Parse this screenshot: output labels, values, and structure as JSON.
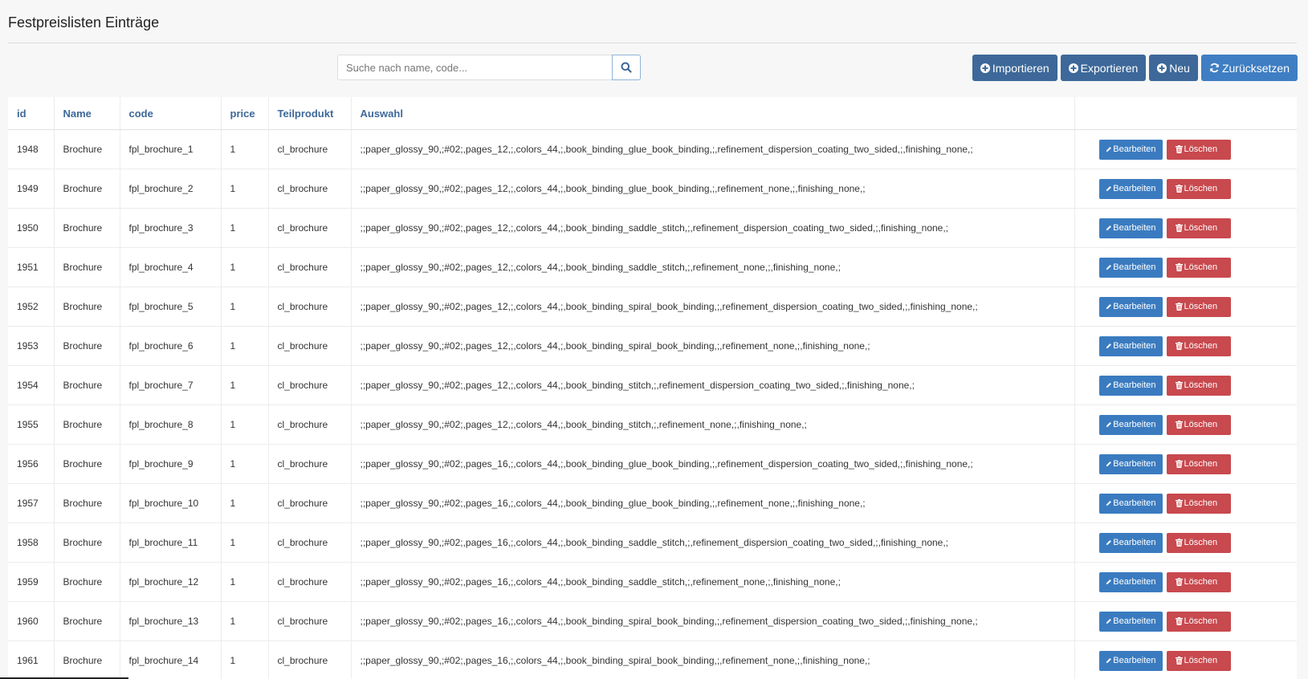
{
  "header": {
    "title": "Festpreislisten Einträge"
  },
  "search": {
    "placeholder": "Suche nach name, code...",
    "value": ""
  },
  "toolbar": {
    "import_label": "Importieren",
    "export_label": "Exportieren",
    "new_label": "Neu",
    "reset_label": "Zurücksetzen"
  },
  "table": {
    "columns": [
      "id",
      "Name",
      "code",
      "price",
      "Teilprodukt",
      "Auswahl"
    ],
    "edit_label": "Bearbeiten",
    "delete_label": "Löschen",
    "rows": [
      {
        "id": "1948",
        "name": "Brochure",
        "code": "fpl_brochure_1",
        "price": "1",
        "teilprodukt": "cl_brochure",
        "auswahl": ";;paper_glossy_90,;#02;,pages_12,;,colors_44,;,book_binding_glue_book_binding,;,refinement_dispersion_coating_two_sided,;,finishing_none,;"
      },
      {
        "id": "1949",
        "name": "Brochure",
        "code": "fpl_brochure_2",
        "price": "1",
        "teilprodukt": "cl_brochure",
        "auswahl": ";;paper_glossy_90,;#02;,pages_12,;,colors_44,;,book_binding_glue_book_binding,;,refinement_none,;,finishing_none,;"
      },
      {
        "id": "1950",
        "name": "Brochure",
        "code": "fpl_brochure_3",
        "price": "1",
        "teilprodukt": "cl_brochure",
        "auswahl": ";;paper_glossy_90,;#02;,pages_12,;,colors_44,;,book_binding_saddle_stitch,;,refinement_dispersion_coating_two_sided,;,finishing_none,;"
      },
      {
        "id": "1951",
        "name": "Brochure",
        "code": "fpl_brochure_4",
        "price": "1",
        "teilprodukt": "cl_brochure",
        "auswahl": ";;paper_glossy_90,;#02;,pages_12,;,colors_44,;,book_binding_saddle_stitch,;,refinement_none,;,finishing_none,;"
      },
      {
        "id": "1952",
        "name": "Brochure",
        "code": "fpl_brochure_5",
        "price": "1",
        "teilprodukt": "cl_brochure",
        "auswahl": ";;paper_glossy_90,;#02;,pages_12,;,colors_44,;,book_binding_spiral_book_binding,;,refinement_dispersion_coating_two_sided,;,finishing_none,;"
      },
      {
        "id": "1953",
        "name": "Brochure",
        "code": "fpl_brochure_6",
        "price": "1",
        "teilprodukt": "cl_brochure",
        "auswahl": ";;paper_glossy_90,;#02;,pages_12,;,colors_44,;,book_binding_spiral_book_binding,;,refinement_none,;,finishing_none,;"
      },
      {
        "id": "1954",
        "name": "Brochure",
        "code": "fpl_brochure_7",
        "price": "1",
        "teilprodukt": "cl_brochure",
        "auswahl": ";;paper_glossy_90,;#02;,pages_12,;,colors_44,;,book_binding_stitch,;,refinement_dispersion_coating_two_sided,;,finishing_none,;"
      },
      {
        "id": "1955",
        "name": "Brochure",
        "code": "fpl_brochure_8",
        "price": "1",
        "teilprodukt": "cl_brochure",
        "auswahl": ";;paper_glossy_90,;#02;,pages_12,;,colors_44,;,book_binding_stitch,;,refinement_none,;,finishing_none,;"
      },
      {
        "id": "1956",
        "name": "Brochure",
        "code": "fpl_brochure_9",
        "price": "1",
        "teilprodukt": "cl_brochure",
        "auswahl": ";;paper_glossy_90,;#02;,pages_16,;,colors_44,;,book_binding_glue_book_binding,;,refinement_dispersion_coating_two_sided,;,finishing_none,;"
      },
      {
        "id": "1957",
        "name": "Brochure",
        "code": "fpl_brochure_10",
        "price": "1",
        "teilprodukt": "cl_brochure",
        "auswahl": ";;paper_glossy_90,;#02;,pages_16,;,colors_44,;,book_binding_glue_book_binding,;,refinement_none,;,finishing_none,;"
      },
      {
        "id": "1958",
        "name": "Brochure",
        "code": "fpl_brochure_11",
        "price": "1",
        "teilprodukt": "cl_brochure",
        "auswahl": ";;paper_glossy_90,;#02;,pages_16,;,colors_44,;,book_binding_saddle_stitch,;,refinement_dispersion_coating_two_sided,;,finishing_none,;"
      },
      {
        "id": "1959",
        "name": "Brochure",
        "code": "fpl_brochure_12",
        "price": "1",
        "teilprodukt": "cl_brochure",
        "auswahl": ";;paper_glossy_90,;#02;,pages_16,;,colors_44,;,book_binding_saddle_stitch,;,refinement_none,;,finishing_none,;"
      },
      {
        "id": "1960",
        "name": "Brochure",
        "code": "fpl_brochure_13",
        "price": "1",
        "teilprodukt": "cl_brochure",
        "auswahl": ";;paper_glossy_90,;#02;,pages_16,;,colors_44,;,book_binding_spiral_book_binding,;,refinement_dispersion_coating_two_sided,;,finishing_none,;"
      },
      {
        "id": "1961",
        "name": "Brochure",
        "code": "fpl_brochure_14",
        "price": "1",
        "teilprodukt": "cl_brochure",
        "auswahl": ";;paper_glossy_90,;#02;,pages_16,;,colors_44,;,book_binding_spiral_book_binding,;,refinement_none,;,finishing_none,;"
      }
    ]
  },
  "colors": {
    "primary": "#3d6899",
    "edit": "#3a7bc0",
    "delete": "#c8494e",
    "header_text": "#3d6899"
  }
}
